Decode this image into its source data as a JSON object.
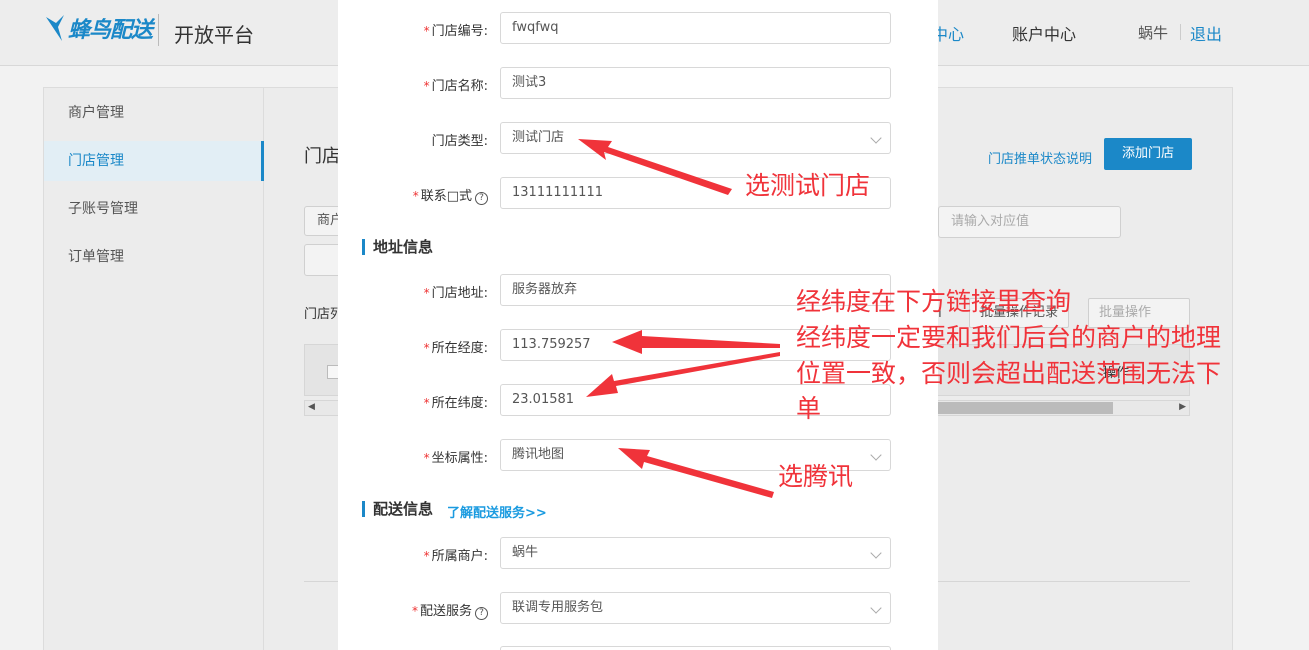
{
  "header": {
    "logo_text": "蜂鸟配送",
    "platform": "开放平台",
    "nav_partial": "中心",
    "nav_account": "账户中心",
    "user": "蜗牛",
    "logout": "退出"
  },
  "sidebar": {
    "items": [
      {
        "label": "商户管理"
      },
      {
        "label": "门店管理"
      },
      {
        "label": "子账号管理"
      },
      {
        "label": "订单管理"
      }
    ]
  },
  "background": {
    "page_title_partial": "门店",
    "push_status_link": "门店推单状态说明",
    "add_store_button": "添加门店",
    "filter_select_partial": "商户",
    "filter_input_placeholder": "请输入对应值",
    "list_label_partial": "门店列",
    "batch_record_partial": "批量操作记录",
    "batch_operate": "批量操作",
    "table_operate": "操作",
    "left_cut_text": "I"
  },
  "modal": {
    "fields": {
      "store_no": {
        "label": "门店编号:",
        "value": "fwqfwq"
      },
      "store_name": {
        "label": "门店名称:",
        "value": "测试3"
      },
      "store_type": {
        "label": "门店类型:",
        "value": "测试门店"
      },
      "contact": {
        "label": "联系□式",
        "value": "13111111111"
      },
      "address": {
        "label": "门店地址:",
        "value": "服务器放弃"
      },
      "longitude": {
        "label": "所在经度:",
        "value": "113.759257"
      },
      "latitude": {
        "label": "所在纬度:",
        "value": "23.01581"
      },
      "coord": {
        "label": "坐标属性:",
        "value": "腾讯地图"
      },
      "merchant": {
        "label": "所属商户:",
        "value": "蜗牛"
      },
      "service": {
        "label": "配送服务",
        "value": "联调专用服务包"
      }
    },
    "sections": {
      "address_info": "地址信息",
      "delivery_info": "配送信息",
      "learn_more": "了解配送服务>>"
    }
  },
  "annotations": {
    "select_test_store": "选测试门店",
    "latlng_line1": "经纬度在下方链接里查询",
    "latlng_line2": "经纬度一定要和我们后台的商户的地理",
    "latlng_line3": "位置一致，否则会超出配送范围无法下",
    "latlng_line4": "单",
    "select_tencent": "选腾讯",
    "color": "#f0333a"
  },
  "colors": {
    "accent": "#1b88c8",
    "required": "#e33"
  }
}
